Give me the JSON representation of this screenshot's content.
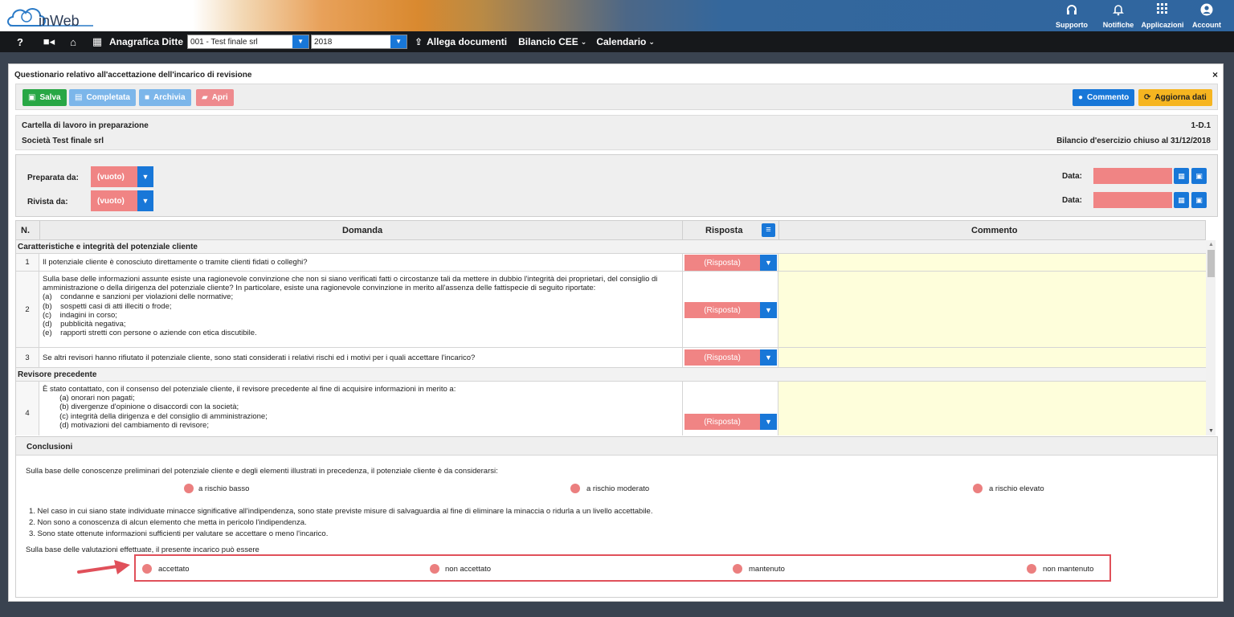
{
  "app": {
    "logo_text": "inWeb"
  },
  "utility": [
    {
      "label": "Supporto",
      "icon": "headset-icon"
    },
    {
      "label": "Notifiche",
      "icon": "bell-icon"
    },
    {
      "label": "Applicazioni",
      "icon": "grid-icon"
    },
    {
      "label": "Account",
      "icon": "user-icon"
    }
  ],
  "nav": {
    "help": "?",
    "anagrafica": "Anagrafica Ditte",
    "company": "001 - Test finale srl",
    "year": "2018",
    "allega": "Allega documenti",
    "bilancio": "Bilancio CEE",
    "calendario": "Calendario"
  },
  "modal": {
    "title": "Questionario relativo all'accettazione dell'incarico di revisione",
    "close": "×"
  },
  "toolbar": {
    "salva": "Salva",
    "completata": "Completata",
    "archivia": "Archivia",
    "apri": "Apri",
    "commento": "Commento",
    "aggiorna": "Aggiorna dati"
  },
  "info": {
    "status": "Cartella di lavoro in preparazione",
    "company": "Società Test finale srl",
    "code": "1-D.1",
    "bilancio": "Bilancio d'esercizio chiuso al 31/12/2018"
  },
  "prep": {
    "preparata_label": "Preparata da:",
    "rivista_label": "Rivista da:",
    "empty": "(vuoto)",
    "data_label": "Data:"
  },
  "table": {
    "col_n": "N.",
    "col_domanda": "Domanda",
    "col_risposta": "Risposta",
    "col_commento": "Commento",
    "placeholder": "(Risposta)",
    "sections": [
      "Caratteristiche e integrità del potenziale cliente",
      "Revisore precedente"
    ],
    "rows": [
      {
        "n": "1",
        "lines": [
          "Il potenziale cliente è conosciuto direttamente o tramite clienti fidati o colleghi?"
        ]
      },
      {
        "n": "2",
        "lines": [
          "Sulla base delle informazioni assunte esiste una ragionevole convinzione che non si siano verificati fatti o circostanze tali da mettere in dubbio l'integrità dei proprietari, del consiglio di",
          "amministrazione o della dirigenza del potenziale cliente? In particolare, esiste una ragionevole convinzione in merito all'assenza delle fattispecie di seguito riportate:",
          "(a)    condanne e sanzioni per violazioni delle normative;",
          "(b)    sospetti casi di atti illeciti o frode;",
          "(c)    indagini in corso;",
          "(d)    pubblicità negativa;",
          "(e)    rapporti stretti con persone o aziende con etica discutibile."
        ]
      },
      {
        "n": "3",
        "lines": [
          "Se altri revisori hanno rifiutato il potenziale cliente, sono stati considerati i relativi rischi ed i motivi per i quali accettare l'incarico?"
        ]
      },
      {
        "n": "4",
        "lines": [
          "È stato contattato, con il consenso del potenziale cliente, il revisore precedente al fine di acquisire informazioni in merito a:",
          "        (a) onorari non pagati;",
          "        (b) divergenze d'opinione o disaccordi con la società;",
          "        (c) integrità della dirigenza e del consiglio di amministrazione;",
          "        (d) motivazioni del cambiamento di revisore;"
        ]
      }
    ]
  },
  "conclusions": {
    "title": "Conclusioni",
    "intro": "Sulla base delle conoscenze preliminari del potenziale cliente e degli elementi illustrati in precedenza, il potenziale cliente è da considerarsi:",
    "risk": [
      "a rischio basso",
      "a rischio moderato",
      "a rischio elevato"
    ],
    "points": [
      "1. Nel caso in cui siano state individuate minacce significative all'indipendenza, sono state previste misure di salvaguardia al fine di eliminare la minaccia o ridurla a un livello accettabile.",
      "2. Non sono a conoscenza di alcun elemento che metta in pericolo l'indipendenza.",
      "3. Sono state ottenute informazioni sufficienti per valutare se accettare o meno l'incarico."
    ],
    "final": "Sulla base delle valutazioni effettuate, il presente incarico può essere",
    "options": [
      "accettato",
      "non accettato",
      "mantenuto",
      "non mantenuto"
    ]
  },
  "colors": {
    "accent": "#1877d8",
    "red": "#f08484",
    "green": "#28a745",
    "orange": "#f6b520",
    "annotation": "#e0505a"
  }
}
